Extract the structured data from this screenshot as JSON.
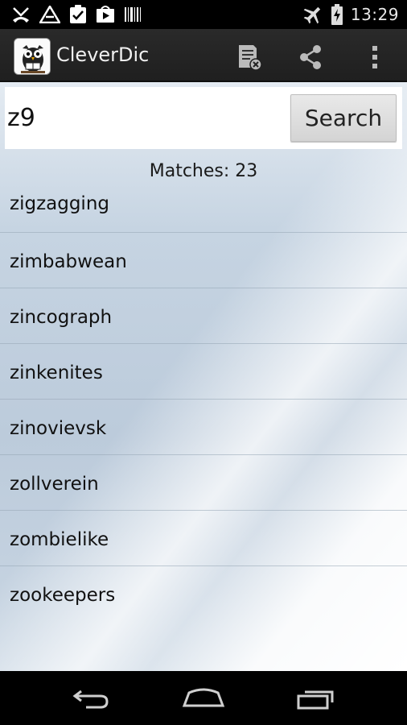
{
  "status_bar": {
    "time": "13:29",
    "left_icons": [
      "missed-call-icon",
      "app-notification-icon",
      "clipboard-check-icon",
      "play-store-icon",
      "barcode-icon"
    ],
    "right_icons": [
      "airplane-mode-icon",
      "battery-charging-icon"
    ]
  },
  "action_bar": {
    "title": "CleverDic",
    "actions": [
      "clear-list-icon",
      "share-icon",
      "overflow-menu-icon"
    ]
  },
  "search": {
    "value": "z9",
    "placeholder": "",
    "button_label": "Search"
  },
  "results": {
    "matches_label": "Matches: 23",
    "items": [
      "zigzagging",
      "zimbabwean",
      "zincograph",
      "zinkenites",
      "zinovievsk",
      "zollverein",
      "zombielike",
      "zookeepers"
    ]
  },
  "nav_bar": {
    "buttons": [
      "back-icon",
      "home-icon",
      "recent-apps-icon"
    ]
  },
  "colors": {
    "action_bar_bg": "#252525",
    "status_bar_bg": "#000000",
    "content_bg": "#c6d4e2"
  }
}
